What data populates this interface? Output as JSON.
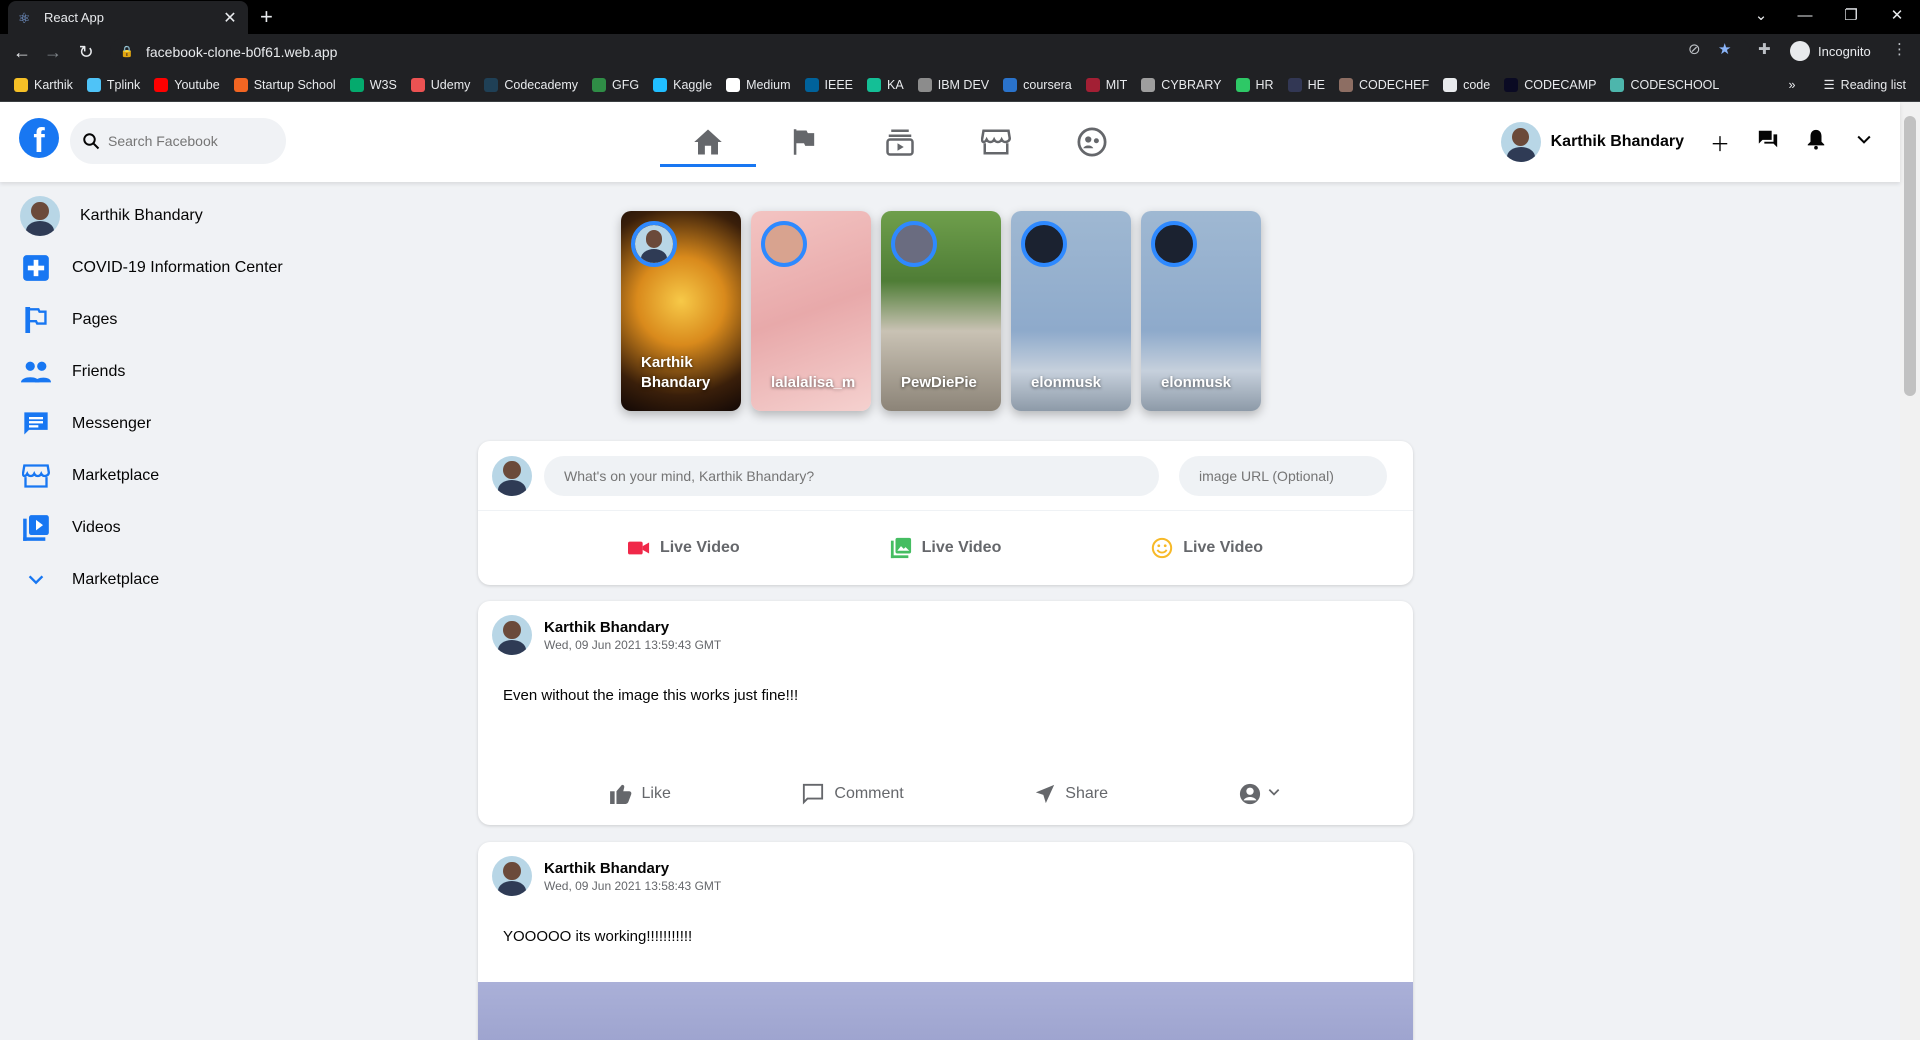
{
  "browser": {
    "tab_title": "React App",
    "url": "facebook-clone-b0f61.web.app",
    "profile_label": "Incognito",
    "bookmarks": [
      {
        "label": "Karthik",
        "color": "#f6c026"
      },
      {
        "label": "Tplink",
        "color": "#4fc3f7"
      },
      {
        "label": "Youtube",
        "color": "#ff0000"
      },
      {
        "label": "Startup School",
        "color": "#f26522"
      },
      {
        "label": "W3S",
        "color": "#04aa6d"
      },
      {
        "label": "Udemy",
        "color": "#ec5252"
      },
      {
        "label": "Codecademy",
        "color": "#1f4056"
      },
      {
        "label": "GFG",
        "color": "#2f8d46"
      },
      {
        "label": "Kaggle",
        "color": "#20beff"
      },
      {
        "label": "Medium",
        "color": "#ffffff"
      },
      {
        "label": "IEEE",
        "color": "#00629b"
      },
      {
        "label": "KA",
        "color": "#14bf96"
      },
      {
        "label": "IBM DEV",
        "color": "#8c8c8c"
      },
      {
        "label": "coursera",
        "color": "#2a73cc"
      },
      {
        "label": "MIT",
        "color": "#a31f34"
      },
      {
        "label": "CYBRARY",
        "color": "#9e9e9e"
      },
      {
        "label": "HR",
        "color": "#2ec866"
      },
      {
        "label": "HE",
        "color": "#323754"
      },
      {
        "label": "CODECHEF",
        "color": "#8d6e63"
      },
      {
        "label": "code",
        "color": "#e8eaed"
      },
      {
        "label": "CODECAMP",
        "color": "#0a0a23"
      },
      {
        "label": "CODESCHOOL",
        "color": "#4db6ac"
      }
    ],
    "more_bookmarks": "»",
    "reading_list": "Reading list"
  },
  "header": {
    "logo": "f",
    "search_placeholder": "Search Facebook",
    "user_name": "Karthik Bhandary",
    "accent": "#1877f2"
  },
  "sidebar": {
    "items": [
      {
        "label": "Karthik Bhandary",
        "icon": "avatar"
      },
      {
        "label": "COVID-19 Information Center",
        "icon": "medical-cross-icon"
      },
      {
        "label": "Pages",
        "icon": "flag-icon"
      },
      {
        "label": "Friends",
        "icon": "people-icon"
      },
      {
        "label": "Messenger",
        "icon": "chat-icon"
      },
      {
        "label": "Marketplace",
        "icon": "storefront-icon"
      },
      {
        "label": "Videos",
        "icon": "video-library-icon"
      },
      {
        "label": "Marketplace",
        "icon": "chevron-down-icon"
      }
    ]
  },
  "stories": [
    {
      "name": "Karthik Bhandary"
    },
    {
      "name": "lalalalisa_m"
    },
    {
      "name": "PewDiePie"
    },
    {
      "name": "elonmusk"
    },
    {
      "name": "elonmusk"
    }
  ],
  "composer": {
    "message_placeholder": "What's on your mind, Karthik Bhandary?",
    "image_placeholder": "image URL (Optional)",
    "actions": [
      "Live Video",
      "Live Video",
      "Live Video"
    ]
  },
  "posts": [
    {
      "author": "Karthik Bhandary",
      "timestamp": "Wed, 09 Jun 2021 13:59:43 GMT",
      "message": "Even without the image this works just fine!!!"
    },
    {
      "author": "Karthik Bhandary",
      "timestamp": "Wed, 09 Jun 2021 13:58:43 GMT",
      "message": "YOOOOO its working!!!!!!!!!!!"
    }
  ],
  "post_actions": {
    "like": "Like",
    "comment": "Comment",
    "share": "Share"
  }
}
